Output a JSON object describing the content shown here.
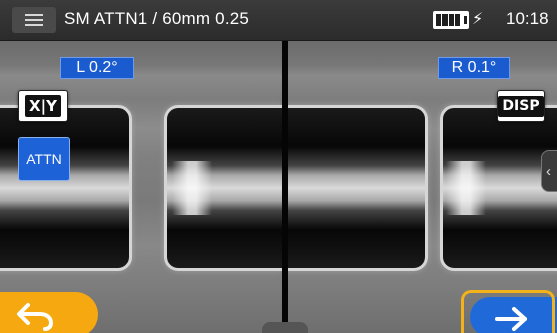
{
  "titlebar": {
    "menu_icon": "hamburger-menu-icon",
    "title": "SM ATTN1 / 60mm 0.25",
    "battery_icon": "battery-full-icon",
    "charging_icon": "charging-bolt-icon",
    "charging_glyph": "⚡",
    "time": "10:18"
  },
  "images": {
    "left_angle": "L  0.2°",
    "right_angle": "R  0.1°"
  },
  "controls": {
    "xy_label": "X|Y",
    "attn_label": "ATTN",
    "disp_label": "DISP",
    "side_tab_glyph": "‹",
    "back_icon": "back-arrow-icon",
    "next_icon": "right-arrow-icon"
  },
  "colors": {
    "accent_blue": "#1e62d8",
    "back_orange": "#f5a810",
    "highlight_yellow": "#f3b21a"
  }
}
